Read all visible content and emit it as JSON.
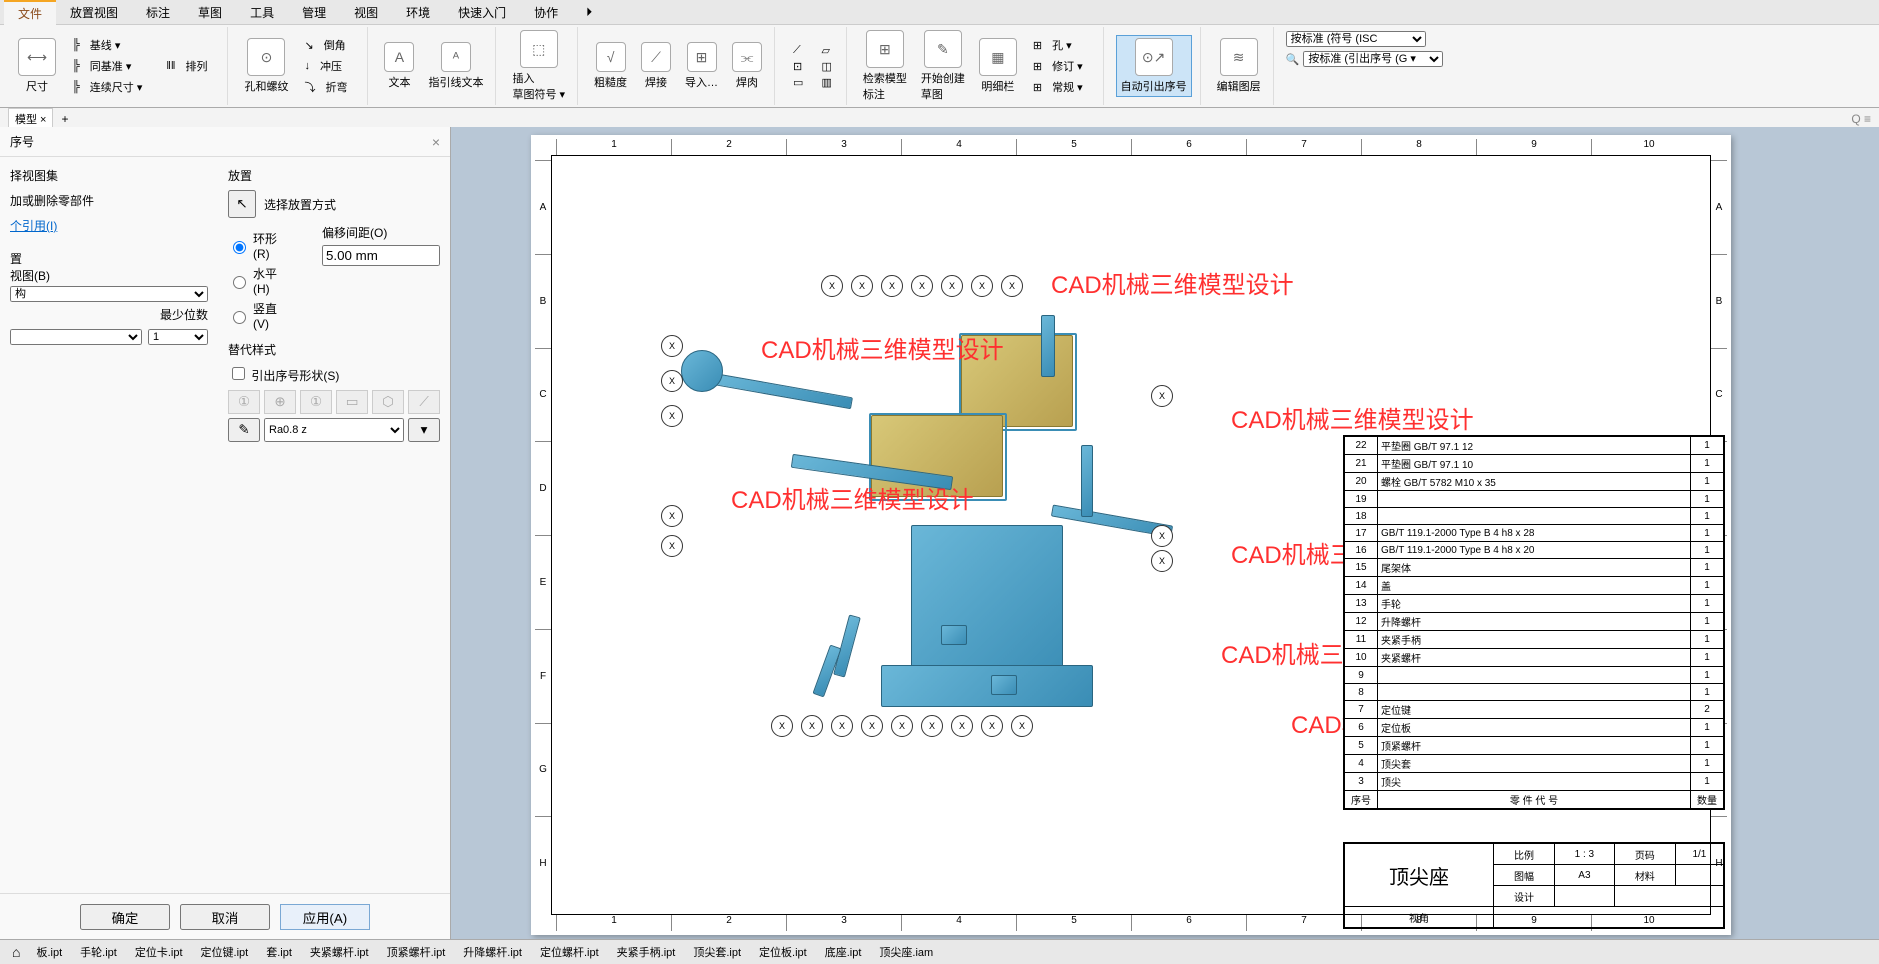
{
  "ribbon": {
    "tabs": [
      "文件",
      "放置视图",
      "标注",
      "草图",
      "工具",
      "管理",
      "视图",
      "环境",
      "快速入门",
      "协作"
    ],
    "active_tab": "标注",
    "dim": {
      "label": "尺寸",
      "items": [
        "基线 ▾",
        "同基准 ▾",
        "连续尺寸 ▾",
        "排列"
      ]
    },
    "feat": {
      "label": "孔和螺纹",
      "items": [
        "倒角",
        "冲压",
        "折弯"
      ]
    },
    "text": {
      "a": "文本",
      "b": "指引线文本"
    },
    "sketch": "插入\n草图符号 ▾",
    "sym": {
      "a": "粗糙度",
      "b": "焊接",
      "c": "导入…",
      "d": "焊肉"
    },
    "ann": {
      "a": "检索模型\n标注",
      "b": "开始创建\n草图",
      "c": "明细栏",
      "hole": "孔 ▾",
      "rev": "修订 ▾",
      "gen": "常规 ▾"
    },
    "auto": "自动引出序号",
    "layer": "编辑图层",
    "combo1": "按标准 (符号 (ISC",
    "combo2": "按标准 (引出序号 (G ▾"
  },
  "doctab": "模型 ×",
  "dialog": {
    "title": "序号",
    "view_label": "择视图集",
    "add_remove": "加或删除零部件",
    "ref_link": "个引用(I)",
    "pos_group": "置",
    "view_opt": "视图(B)",
    "struct": "构",
    "min_digits": "最少位数",
    "min_val": "1",
    "placement": "放置",
    "place_btn": "选择放置方式",
    "r_ring": "环形(R)",
    "r_horiz": "水平(H)",
    "r_vert": "竖直(V)",
    "offset_lbl": "偏移间距(O)",
    "offset_val": "5.00 mm",
    "override": "替代样式",
    "shape_chk": "引出序号形状(S)",
    "ra": "Ra0.8 z",
    "ok": "确定",
    "cancel": "取消",
    "apply": "应用(A)"
  },
  "cols": [
    "1",
    "2",
    "3",
    "4",
    "5",
    "6",
    "7",
    "8",
    "9",
    "10"
  ],
  "rows": [
    "A",
    "B",
    "C",
    "D",
    "E",
    "F",
    "G",
    "H"
  ],
  "parts_list": {
    "header_num": "序号",
    "header_code": "零 件 代 号",
    "header_qty": "数量",
    "rows": [
      {
        "n": "22",
        "d": "平垫圈 GB/T 97.1 12",
        "q": "1"
      },
      {
        "n": "21",
        "d": "平垫圈 GB/T 97.1 10",
        "q": "1"
      },
      {
        "n": "20",
        "d": "螺栓 GB/T 5782 M10 x 35",
        "q": "1"
      },
      {
        "n": "19",
        "d": "",
        "q": "1"
      },
      {
        "n": "18",
        "d": "",
        "q": "1"
      },
      {
        "n": "17",
        "d": "GB/T 119.1-2000 Type B 4 h8 x 28",
        "q": "1"
      },
      {
        "n": "16",
        "d": "GB/T 119.1-2000 Type B 4 h8 x 20",
        "q": "1"
      },
      {
        "n": "15",
        "d": "尾架体",
        "q": "1"
      },
      {
        "n": "14",
        "d": "盖",
        "q": "1"
      },
      {
        "n": "13",
        "d": "手轮",
        "q": "1"
      },
      {
        "n": "12",
        "d": "升降螺杆",
        "q": "1"
      },
      {
        "n": "11",
        "d": "夹紧手柄",
        "q": "1"
      },
      {
        "n": "10",
        "d": "夹紧螺杆",
        "q": "1"
      },
      {
        "n": "9",
        "d": "",
        "q": "1"
      },
      {
        "n": "8",
        "d": "",
        "q": "1"
      },
      {
        "n": "7",
        "d": "定位键",
        "q": "2"
      },
      {
        "n": "6",
        "d": "定位板",
        "q": "1"
      },
      {
        "n": "5",
        "d": "顶紧螺杆",
        "q": "1"
      },
      {
        "n": "4",
        "d": "顶尖套",
        "q": "1"
      },
      {
        "n": "3",
        "d": "顶尖",
        "q": "1"
      }
    ]
  },
  "titleblock": {
    "name": "顶尖座",
    "scale_l": "比例",
    "scale_v": "1 : 3",
    "page_l": "页码",
    "page_v": "1/1",
    "format_l": "图幅",
    "format_v": "A3",
    "mat_l": "材料",
    "des_l": "设计",
    "view_l": "视角"
  },
  "watermark": "CAD机械三维模型设计",
  "balloon": "X",
  "status": {
    "files": [
      "板.ipt",
      "手轮.ipt",
      "定位卡.ipt",
      "定位键.ipt",
      "套.ipt",
      "夹紧螺杆.ipt",
      "顶紧螺杆.ipt",
      "升降螺杆.ipt",
      "定位螺杆.ipt",
      "夹紧手柄.ipt",
      "顶尖套.ipt",
      "定位板.ipt",
      "底座.ipt",
      "顶尖座.iam"
    ]
  }
}
